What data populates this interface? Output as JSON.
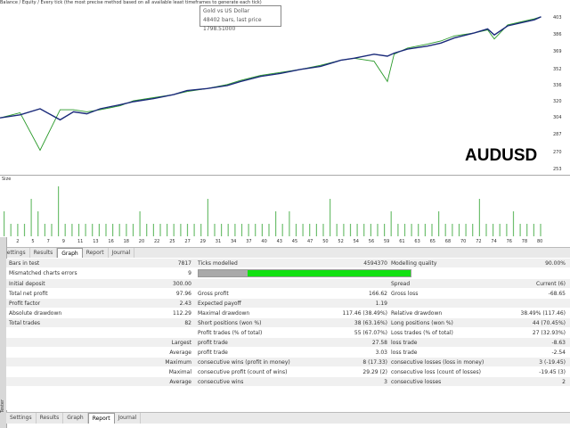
{
  "graph": {
    "header": "Balance / Equity / Every tick (the most precise method based on all available least timeframes to generate each tick)",
    "tooltip": {
      "line1": "Gold vs US Dollar",
      "line2": "48402 bars, last price 1798.51000"
    },
    "symbol_label": "AUDUSD",
    "size_label": "Size",
    "y_labels": [
      "403",
      "386",
      "369",
      "352",
      "336",
      "320",
      "304",
      "287",
      "270",
      "253"
    ],
    "x_labels": [
      "0",
      "2",
      "5",
      "7",
      "9",
      "11",
      "13",
      "16",
      "18",
      "20",
      "22",
      "25",
      "27",
      "29",
      "31",
      "34",
      "37",
      "40",
      "43",
      "45",
      "47",
      "50",
      "52",
      "54",
      "56",
      "59",
      "61",
      "63",
      "65",
      "68",
      "70",
      "72",
      "74",
      "76",
      "78",
      "80"
    ],
    "colors": {
      "balance": "#1a2a7a",
      "equity": "#2a9a2a",
      "size_bars": "#6fbf6f"
    }
  },
  "chart_data": {
    "type": "line",
    "x": [
      0,
      3,
      6,
      9,
      11,
      13,
      15,
      18,
      20,
      23,
      26,
      28,
      31,
      34,
      36,
      39,
      42,
      45,
      48,
      51,
      53,
      56,
      58,
      59,
      61,
      64,
      66,
      68,
      71,
      73,
      74,
      76,
      78,
      80,
      81
    ],
    "series": [
      {
        "name": "Balance",
        "values": [
          304,
          307,
          313,
          302,
          310,
          308,
          313,
          317,
          320,
          323,
          327,
          331,
          333,
          336,
          340,
          345,
          348,
          352,
          355,
          361,
          363,
          367,
          365,
          368,
          372,
          375,
          378,
          383,
          388,
          392,
          386,
          395,
          398,
          401,
          404
        ]
      },
      {
        "name": "Equity",
        "values": [
          304,
          309,
          272,
          312,
          312,
          310,
          312,
          316,
          321,
          324,
          327,
          330,
          333,
          337,
          341,
          346,
          349,
          352,
          356,
          361,
          363,
          360,
          340,
          367,
          373,
          377,
          380,
          385,
          388,
          391,
          382,
          396,
          399,
          402,
          404
        ]
      }
    ],
    "ylim": [
      253,
      410
    ],
    "size_bars": [
      2,
      1,
      1,
      1,
      3,
      2,
      1,
      1,
      4,
      1,
      1,
      1,
      1,
      1,
      1,
      1,
      1,
      1,
      1,
      1,
      2,
      1,
      1,
      1,
      1,
      1,
      1,
      1,
      1,
      1,
      3,
      1,
      1,
      1,
      1,
      1,
      1,
      1,
      1,
      1,
      2,
      1,
      2,
      1,
      1,
      1,
      1,
      1,
      3,
      1,
      1,
      1,
      1,
      1,
      1,
      1,
      1,
      2,
      1,
      1,
      1,
      1,
      1,
      1,
      2,
      1,
      1,
      1,
      1,
      1,
      3,
      1,
      1,
      1,
      1,
      2,
      1,
      1,
      1,
      1
    ]
  },
  "top_tabs": [
    "Settings",
    "Results",
    "Graph",
    "Report",
    "Journal"
  ],
  "bottom_tabs": [
    "Settings",
    "Results",
    "Graph",
    "Report",
    "Journal"
  ],
  "side_label": "Tester",
  "report": {
    "bars_in_test": {
      "label": "Bars in test",
      "value": "7817"
    },
    "ticks_modelled": {
      "label": "Ticks modelled",
      "value": "4594370"
    },
    "modelling_quality": {
      "label": "Modelling quality",
      "value": "90.00%"
    },
    "modelling_quality_fraction": 0.9,
    "mismatched": {
      "label": "Mismatched charts errors",
      "value": "9"
    },
    "initial_deposit": {
      "label": "Initial deposit",
      "value": "300.00"
    },
    "spread": {
      "label": "Spread",
      "value": "Current (6)"
    },
    "total_net_profit": {
      "label": "Total net profit",
      "value": "97.96"
    },
    "gross_profit": {
      "label": "Gross profit",
      "value": "166.62"
    },
    "gross_loss": {
      "label": "Gross loss",
      "value": "-68.65"
    },
    "profit_factor": {
      "label": "Profit factor",
      "value": "2.43"
    },
    "expected_payoff": {
      "label": "Expected payoff",
      "value": "1.19"
    },
    "absolute_drawdown": {
      "label": "Absolute drawdown",
      "value": "112.29"
    },
    "maximal_drawdown": {
      "label": "Maximal drawdown",
      "value": "117.46 (38.49%)"
    },
    "relative_drawdown": {
      "label": "Relative drawdown",
      "value": "38.49% (117.46)"
    },
    "total_trades": {
      "label": "Total trades",
      "value": "82"
    },
    "short_positions": {
      "label": "Short positions (won %)",
      "value": "38 (63.16%)"
    },
    "long_positions": {
      "label": "Long positions (won %)",
      "value": "44 (70.45%)"
    },
    "profit_trades": {
      "label": "Profit trades (% of total)",
      "value": "55 (67.07%)"
    },
    "loss_trades": {
      "label": "Loss trades (% of total)",
      "value": "27 (32.93%)"
    },
    "largest": {
      "label": "Largest",
      "p_label": "profit trade",
      "p_value": "27.58",
      "l_label": "loss trade",
      "l_value": "-8.63"
    },
    "average": {
      "label": "Average",
      "p_label": "profit trade",
      "p_value": "3.03",
      "l_label": "loss trade",
      "l_value": "-2.54"
    },
    "maximum": {
      "label": "Maximum",
      "p_label": "consecutive wins (profit in money)",
      "p_value": "8 (17.33)",
      "l_label": "consecutive losses (loss in money)",
      "l_value": "3 (-19.45)"
    },
    "maximal": {
      "label": "Maximal",
      "p_label": "consecutive profit (count of wins)",
      "p_value": "29.29 (2)",
      "l_label": "consecutive loss (count of losses)",
      "l_value": "-19.45 (3)"
    },
    "average2": {
      "label": "Average",
      "p_label": "consecutive wins",
      "p_value": "3",
      "l_label": "consecutive losses",
      "l_value": "2"
    }
  }
}
